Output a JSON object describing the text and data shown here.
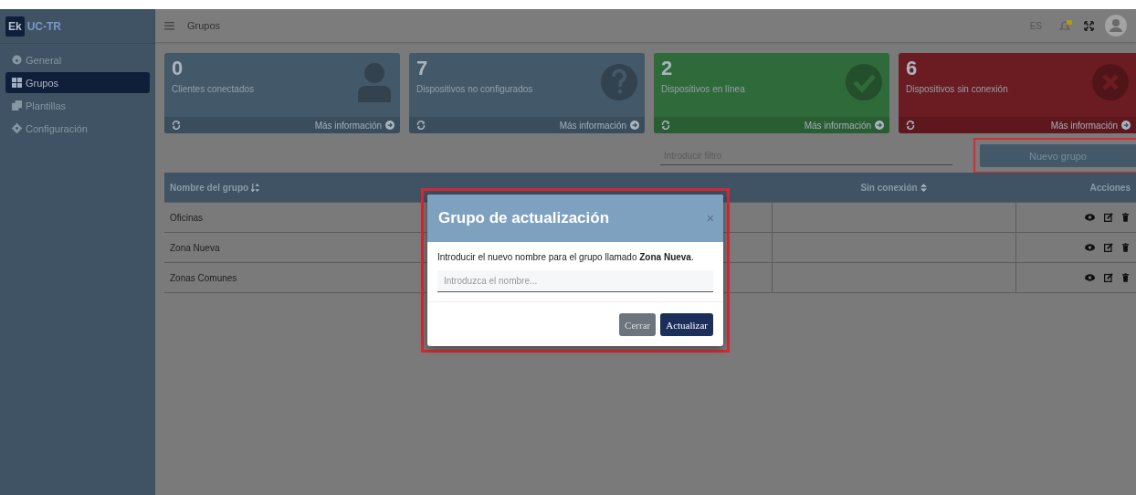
{
  "brand": {
    "badge": "Ek",
    "name": "UC-TR"
  },
  "sidebar": {
    "items": [
      {
        "label": "General",
        "selected": false
      },
      {
        "label": "Grupos",
        "selected": true
      },
      {
        "label": "Plantillas",
        "selected": false
      },
      {
        "label": "Configuración",
        "selected": false
      }
    ]
  },
  "topbar": {
    "title": "Grupos",
    "language": "ES"
  },
  "cards": [
    {
      "kind": "clients",
      "count": "0",
      "label": "Clientes conectados",
      "link": "Más información",
      "color": "#435869"
    },
    {
      "kind": "unconfigured",
      "count": "7",
      "label": "Dispositivos no configurados",
      "link": "Más información",
      "color": "#435869"
    },
    {
      "kind": "online",
      "count": "2",
      "label": "Dispositivos en línea",
      "link": "Más información",
      "color": "#2f6a3a"
    },
    {
      "kind": "offline",
      "count": "6",
      "label": "Dispositivos sin conexión",
      "link": "Más información",
      "color": "#6b1c22"
    }
  ],
  "filter": {
    "placeholder": "Introducir filtro"
  },
  "new_button": "Nuevo grupo",
  "table": {
    "columns": [
      {
        "label": "Nombre del grupo",
        "sorted": true
      },
      {
        "label": "Sin conexión",
        "sorted": false
      },
      {
        "label": "Acciones",
        "sorted": false
      }
    ],
    "rows": [
      {
        "name": "Oficinas"
      },
      {
        "name": "Zona Nueva"
      },
      {
        "name": "Zonas Comunes"
      }
    ]
  },
  "modal": {
    "title": "Grupo de actualización",
    "close": "×",
    "message": "Introducir el nuevo nombre para el grupo llamado **Zona Nueva**.",
    "placeholder": "Introduzca el nombre...",
    "buttons": [
      {
        "label": "Cerrar",
        "kind": "secondary"
      },
      {
        "label": "Actualizar",
        "kind": "primary"
      }
    ]
  }
}
